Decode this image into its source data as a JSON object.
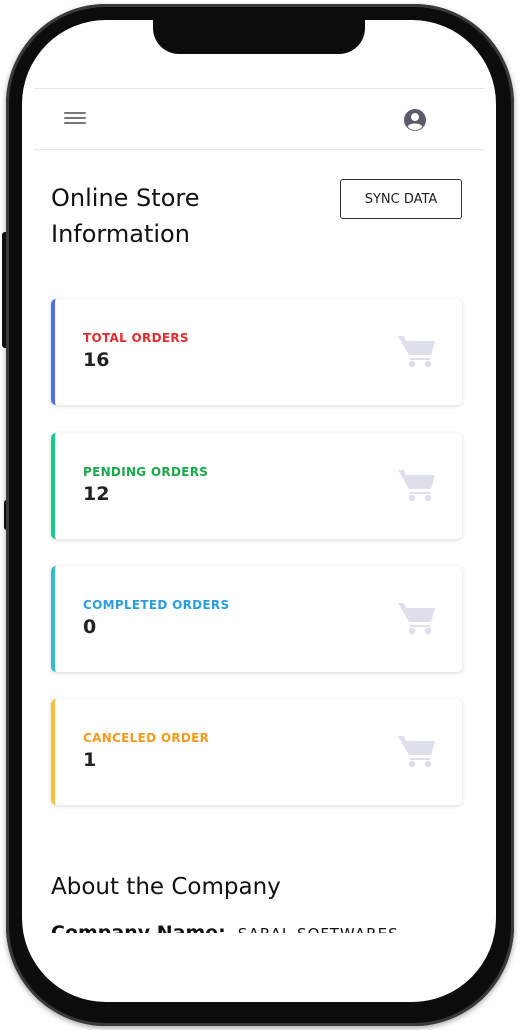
{
  "header": {
    "menu_icon": "menu-icon",
    "account_icon": "account-circle-icon"
  },
  "main": {
    "title": "Online Store Information",
    "sync_button_label": "SYNC DATA",
    "cards": [
      {
        "label": "TOTAL ORDERS",
        "value": "16",
        "accent": "#4e73df",
        "label_color": "#e02d2d",
        "icon": "cart-icon"
      },
      {
        "label": "PENDING ORDERS",
        "value": "12",
        "accent": "#1cc88a",
        "label_color": "#1aa84b",
        "icon": "cart-icon"
      },
      {
        "label": "COMPLETED ORDERS",
        "value": "0",
        "accent": "#36b9cc",
        "label_color": "#2a9de0",
        "icon": "cart-icon"
      },
      {
        "label": "CANCELED ORDER",
        "value": "1",
        "accent": "#f6c23e",
        "label_color": "#f59a1e",
        "icon": "cart-icon"
      }
    ],
    "about": {
      "title": "About the Company",
      "company_name_key": "Company Name:",
      "company_name_value": "SARAL SOFTWARES"
    }
  },
  "colors": {
    "cart_icon": "#dddfeb",
    "text": "#111111"
  }
}
